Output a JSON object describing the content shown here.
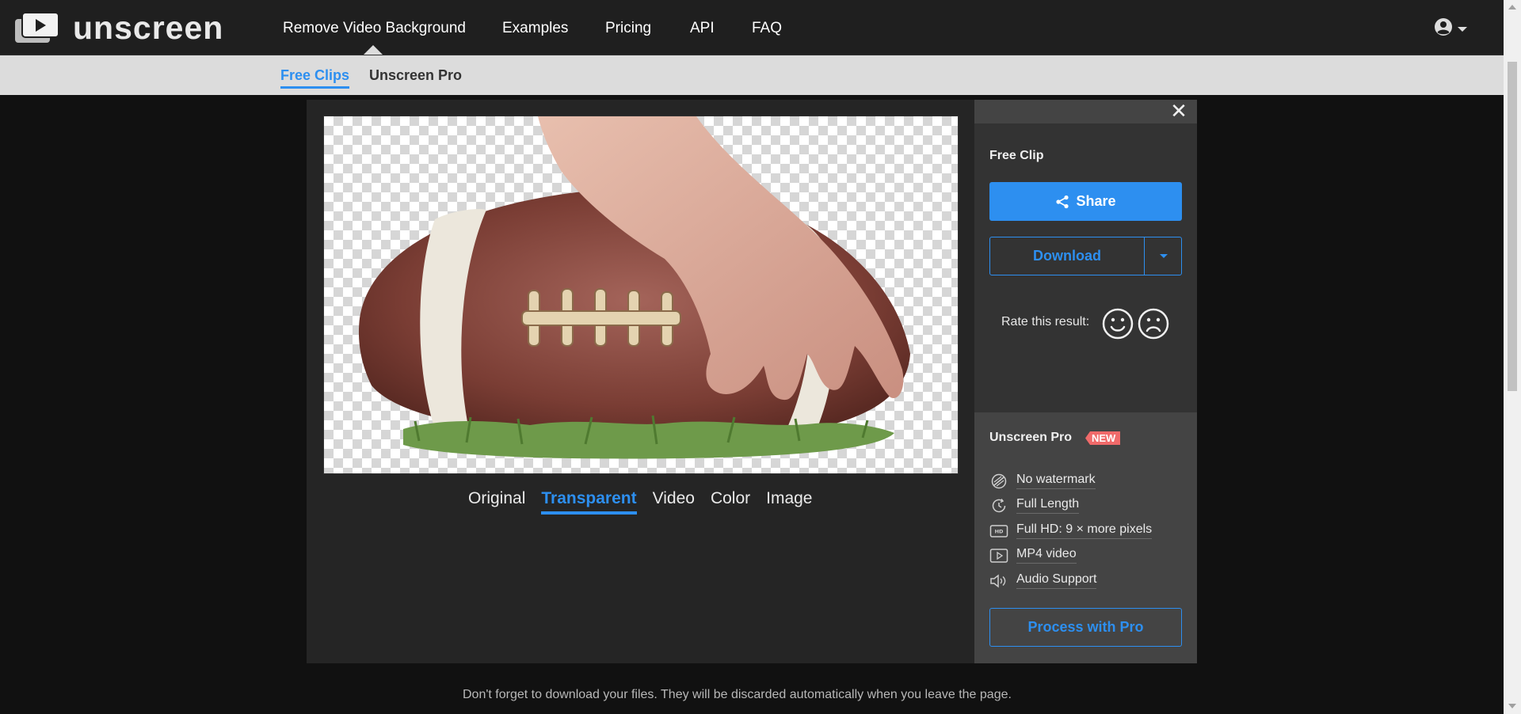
{
  "app": {
    "brand": "unscreen"
  },
  "nav": {
    "items": [
      {
        "label": "Remove Video Background"
      },
      {
        "label": "Examples"
      },
      {
        "label": "Pricing"
      },
      {
        "label": "API"
      },
      {
        "label": "FAQ"
      }
    ],
    "active_index": 0
  },
  "subnav": {
    "items": [
      {
        "label": "Free Clips",
        "active": true
      },
      {
        "label": "Unscreen Pro",
        "active": false
      }
    ]
  },
  "preview": {
    "tabs": [
      {
        "label": "Original"
      },
      {
        "label": "Transparent"
      },
      {
        "label": "Video"
      },
      {
        "label": "Color"
      },
      {
        "label": "Image"
      }
    ],
    "active_tab": "Transparent"
  },
  "panel": {
    "title": "Free Clip",
    "share_label": "Share",
    "download_label": "Download",
    "rate_label": "Rate this result:",
    "pro": {
      "title": "Unscreen Pro",
      "badge": "NEW",
      "features": [
        {
          "icon": "no-watermark-icon",
          "label": "No watermark"
        },
        {
          "icon": "full-length-icon",
          "label": "Full Length"
        },
        {
          "icon": "hd-icon",
          "label": "Full HD: 9 × more pixels"
        },
        {
          "icon": "mp4-video-icon",
          "label": "MP4 video"
        },
        {
          "icon": "audio-icon",
          "label": "Audio Support"
        }
      ],
      "button_label": "Process with Pro"
    }
  },
  "footer": {
    "note": "Don't forget to download your files. They will be discarded automatically when you leave the page."
  },
  "colors": {
    "accent": "#2d8ff0",
    "navbar": "#1f1f1f",
    "subnav": "#dcdcdc",
    "badge": "#f06a6a"
  }
}
